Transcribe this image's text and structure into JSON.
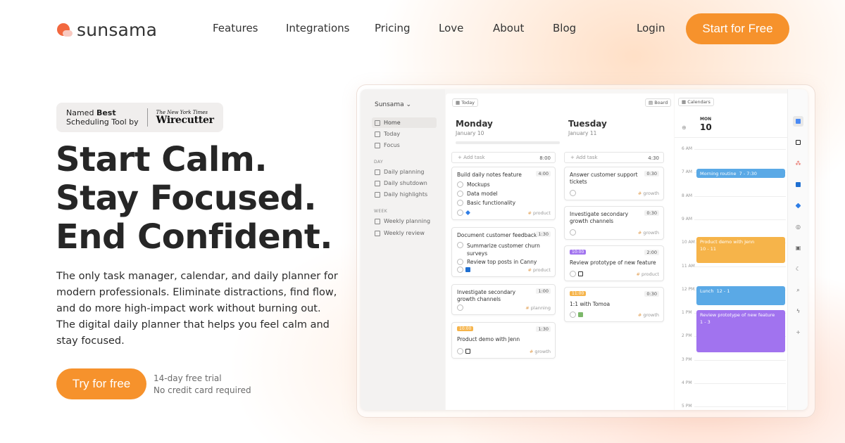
{
  "brand": {
    "name": "sunsama"
  },
  "nav": {
    "links": [
      "Features",
      "Integrations",
      "Pricing",
      "Love",
      "About",
      "Blog"
    ],
    "login": "Login",
    "cta": "Start for Free"
  },
  "badge": {
    "line1_prefix": "Named ",
    "line1_bold": "Best",
    "line2": "Scheduling Tool by",
    "publisher_top": "The New York Times",
    "publisher": "Wirecutter"
  },
  "hero": {
    "headline": [
      "Start Calm.",
      "Stay Focused.",
      "End Confident."
    ],
    "description": "The only task manager, calendar, and daily planner for modern professionals. Eliminate distractions, find flow, and do more high-impact work without burning out. The digital daily planner that helps you feel calm and stay focused.",
    "cta": "Try for free",
    "trial_line1": "14-day free trial",
    "trial_line2": "No credit card required"
  },
  "app": {
    "workspace": "Sunsama",
    "sidebar": {
      "items": [
        "Home",
        "Today",
        "Focus"
      ],
      "day_section": "DAY",
      "day_items": [
        "Daily planning",
        "Daily shutdown",
        "Daily highlights"
      ],
      "week_section": "WEEK",
      "week_items": [
        "Weekly planning",
        "Weekly review"
      ]
    },
    "toolbar": {
      "today": "Today",
      "board": "Board",
      "calendars": "Calendars"
    },
    "add_task": "Add task",
    "monday": {
      "name": "Monday",
      "date": "January 10",
      "add_time": "8:00",
      "cards": [
        {
          "title": "Build daily notes feature",
          "time": "4:00",
          "subtasks": [
            "Mockups",
            "Data model",
            "Basic functionality"
          ],
          "tag": "product"
        },
        {
          "title": "Document customer feedback",
          "time": "1:30",
          "subtasks": [
            "Summarize customer churn surveys",
            "Review top posts in Canny"
          ],
          "tag": "product"
        },
        {
          "title": "Investigate secondary growth channels",
          "time": "1:00",
          "tag": "planning"
        },
        {
          "stamp": "10:00",
          "title": "Product demo with Jenn",
          "time": "1:30",
          "tag": "growth"
        }
      ]
    },
    "tuesday": {
      "name": "Tuesday",
      "date": "January 11",
      "add_time": "4:30",
      "cards": [
        {
          "title": "Answer customer support tickets",
          "time": "0:30",
          "tag": "growth"
        },
        {
          "title": "Investigate secondary growth channels",
          "time": "0:30",
          "tag": "growth"
        },
        {
          "stamp": "10:00",
          "title": "Review prototype of new feature",
          "time": "2:00",
          "tag": "product"
        },
        {
          "stamp": "11:00",
          "title": "1:1 with Tomoa",
          "time": "0:30",
          "tag": "growth"
        }
      ]
    },
    "calendar": {
      "day_label": "MON",
      "day_num": "10",
      "hours": [
        "6 AM",
        "7 AM",
        "8 AM",
        "9 AM",
        "10 AM",
        "11 AM",
        "12 PM",
        "1 PM",
        "2 PM",
        "3 PM",
        "4 PM",
        "5 PM"
      ],
      "events": [
        {
          "title": "Morning routine",
          "time": "7 - 7:30",
          "color": "#5aa9e6"
        },
        {
          "title": "Product demo with Jenn",
          "time": "10 - 11",
          "color": "#f6b44a"
        },
        {
          "title": "Lunch",
          "time": "12 - 1",
          "color": "#5aa9e6"
        },
        {
          "title": "Review prototype of new feature",
          "time": "1 - 3",
          "color": "#a173ef"
        }
      ]
    }
  },
  "colors": {
    "accent": "#f6922c",
    "stamp_purple": "#a173ef",
    "stamp_orange": "#f6b44a"
  }
}
